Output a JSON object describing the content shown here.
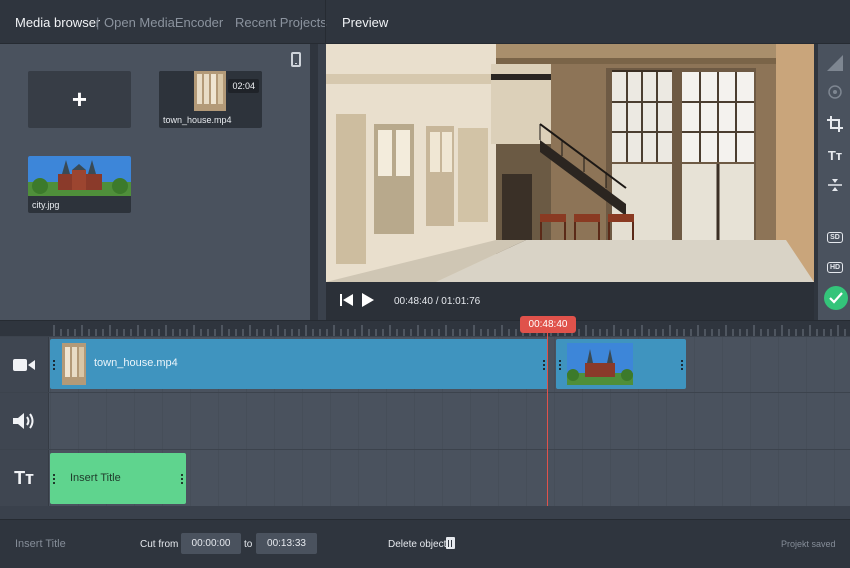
{
  "topbar": {
    "media_browser": "Media browser",
    "separator": "|",
    "open_encoder": "Open MediaEncoder",
    "recent_projects": "Recent Projects",
    "preview": "Preview"
  },
  "media": {
    "add_symbol": "+",
    "items": [
      {
        "name": "town_house.mp4",
        "duration": "02:04"
      },
      {
        "name": "city.jpg"
      }
    ]
  },
  "player": {
    "timecode": "00:48:40 / 01:01:76"
  },
  "tools": {
    "text_tool": "Tт",
    "sd_label": "SD",
    "hd_label": "HD"
  },
  "timeline": {
    "playhead": "00:48:40",
    "video_clip_label": "town_house.mp4",
    "title_clip_label": "Insert Title",
    "title_track_icon": "Tт"
  },
  "bottombar": {
    "title_placeholder": "Insert Title",
    "cut_from_label": "Cut from",
    "cut_from_value": "00:00:00",
    "to_label": "to",
    "cut_to_value": "00:13:33",
    "delete_label": "Delete object",
    "status": "Projekt saved"
  },
  "colors": {
    "accent_red": "#e0524b",
    "clip_blue": "#3f94bf",
    "title_green": "#5fd48e",
    "check_green": "#34c47a"
  }
}
